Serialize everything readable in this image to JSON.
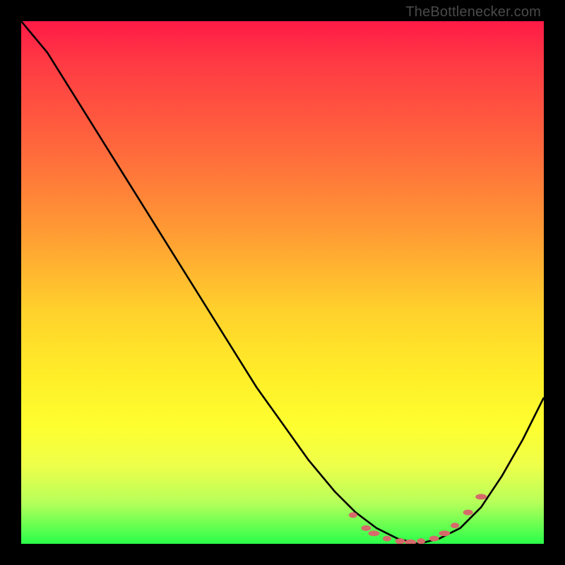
{
  "watermark": {
    "text": "TheBottlenecker.com"
  },
  "colors": {
    "background": "#000000",
    "curve": "#000000",
    "markers": "#d66a6a"
  },
  "chart_data": {
    "type": "line",
    "title": "",
    "xlabel": "",
    "ylabel": "",
    "xlim": [
      0,
      1
    ],
    "ylim": [
      0,
      1
    ],
    "grid": false,
    "legend": false,
    "series": [
      {
        "name": "curve",
        "x": [
          0.0,
          0.05,
          0.1,
          0.15,
          0.2,
          0.25,
          0.3,
          0.35,
          0.4,
          0.45,
          0.5,
          0.55,
          0.6,
          0.64,
          0.68,
          0.72,
          0.76,
          0.8,
          0.84,
          0.88,
          0.92,
          0.96,
          1.0
        ],
        "y": [
          1.0,
          0.94,
          0.86,
          0.78,
          0.7,
          0.62,
          0.54,
          0.46,
          0.38,
          0.3,
          0.23,
          0.16,
          0.1,
          0.06,
          0.03,
          0.01,
          0.0,
          0.01,
          0.03,
          0.07,
          0.13,
          0.2,
          0.28
        ]
      }
    ],
    "markers": {
      "name": "dotted-segment",
      "x": [
        0.635,
        0.66,
        0.675,
        0.7,
        0.725,
        0.745,
        0.765,
        0.79,
        0.81,
        0.83,
        0.855,
        0.88
      ],
      "y": [
        0.055,
        0.03,
        0.02,
        0.01,
        0.005,
        0.003,
        0.005,
        0.01,
        0.02,
        0.035,
        0.06,
        0.09
      ]
    }
  }
}
